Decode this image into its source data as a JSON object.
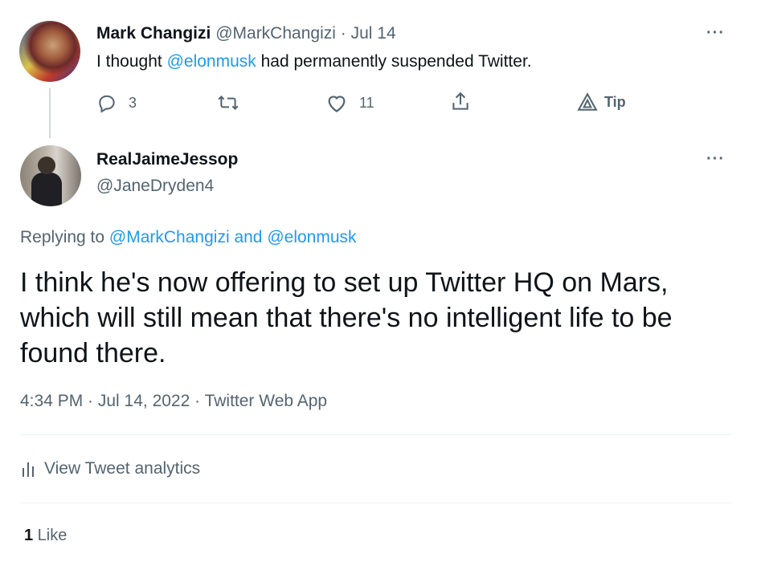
{
  "tweet1": {
    "author_name": "Mark Changizi",
    "handle": "@MarkChangizi",
    "separator": "·",
    "date": "Jul 14",
    "text_before": "I thought ",
    "mention": "@elonmusk",
    "text_after": " had permanently suspended Twitter.",
    "more": "···",
    "actions": {
      "reply_count": "3",
      "retweet_count": "",
      "like_count": "11",
      "tip_label": "Tip"
    }
  },
  "tweet2": {
    "author_name": "RealJaimeJessop",
    "handle": "@JaneDryden4",
    "more": "···",
    "replying_prefix": "Replying to ",
    "replying_user1": "@MarkChangizi",
    "replying_and": " and ",
    "replying_user2": "@elonmusk",
    "text": "I think he's now offering to set up Twitter HQ on Mars, which will still mean that there's no intelligent life to be found there.",
    "meta": "4:34 PM · Jul 14, 2022 · Twitter Web App",
    "analytics_label": "View Tweet analytics",
    "like_count": "1",
    "like_label": " Like"
  },
  "colors": {
    "accent": "#1d9bf0",
    "muted": "#536471",
    "text": "#0f1419",
    "divider": "#eff3f4"
  },
  "icons": [
    "reply-icon",
    "retweet-icon",
    "like-icon",
    "share-icon",
    "tip-icon",
    "analytics-icon",
    "more-icon"
  ]
}
